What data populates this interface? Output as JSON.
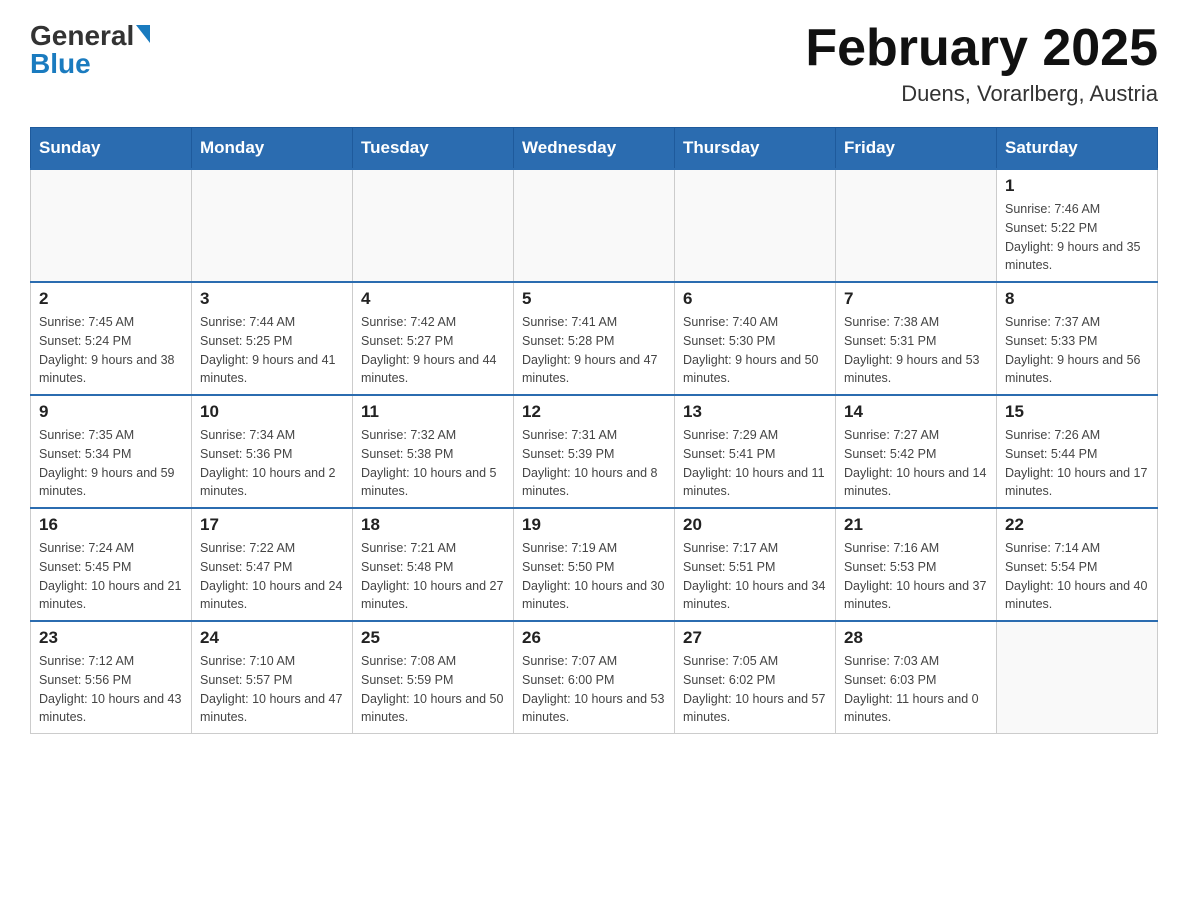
{
  "header": {
    "logo_general": "General",
    "logo_blue": "Blue",
    "month_title": "February 2025",
    "location": "Duens, Vorarlberg, Austria"
  },
  "weekdays": [
    "Sunday",
    "Monday",
    "Tuesday",
    "Wednesday",
    "Thursday",
    "Friday",
    "Saturday"
  ],
  "weeks": [
    [
      {
        "day": "",
        "info": ""
      },
      {
        "day": "",
        "info": ""
      },
      {
        "day": "",
        "info": ""
      },
      {
        "day": "",
        "info": ""
      },
      {
        "day": "",
        "info": ""
      },
      {
        "day": "",
        "info": ""
      },
      {
        "day": "1",
        "info": "Sunrise: 7:46 AM\nSunset: 5:22 PM\nDaylight: 9 hours and 35 minutes."
      }
    ],
    [
      {
        "day": "2",
        "info": "Sunrise: 7:45 AM\nSunset: 5:24 PM\nDaylight: 9 hours and 38 minutes."
      },
      {
        "day": "3",
        "info": "Sunrise: 7:44 AM\nSunset: 5:25 PM\nDaylight: 9 hours and 41 minutes."
      },
      {
        "day": "4",
        "info": "Sunrise: 7:42 AM\nSunset: 5:27 PM\nDaylight: 9 hours and 44 minutes."
      },
      {
        "day": "5",
        "info": "Sunrise: 7:41 AM\nSunset: 5:28 PM\nDaylight: 9 hours and 47 minutes."
      },
      {
        "day": "6",
        "info": "Sunrise: 7:40 AM\nSunset: 5:30 PM\nDaylight: 9 hours and 50 minutes."
      },
      {
        "day": "7",
        "info": "Sunrise: 7:38 AM\nSunset: 5:31 PM\nDaylight: 9 hours and 53 minutes."
      },
      {
        "day": "8",
        "info": "Sunrise: 7:37 AM\nSunset: 5:33 PM\nDaylight: 9 hours and 56 minutes."
      }
    ],
    [
      {
        "day": "9",
        "info": "Sunrise: 7:35 AM\nSunset: 5:34 PM\nDaylight: 9 hours and 59 minutes."
      },
      {
        "day": "10",
        "info": "Sunrise: 7:34 AM\nSunset: 5:36 PM\nDaylight: 10 hours and 2 minutes."
      },
      {
        "day": "11",
        "info": "Sunrise: 7:32 AM\nSunset: 5:38 PM\nDaylight: 10 hours and 5 minutes."
      },
      {
        "day": "12",
        "info": "Sunrise: 7:31 AM\nSunset: 5:39 PM\nDaylight: 10 hours and 8 minutes."
      },
      {
        "day": "13",
        "info": "Sunrise: 7:29 AM\nSunset: 5:41 PM\nDaylight: 10 hours and 11 minutes."
      },
      {
        "day": "14",
        "info": "Sunrise: 7:27 AM\nSunset: 5:42 PM\nDaylight: 10 hours and 14 minutes."
      },
      {
        "day": "15",
        "info": "Sunrise: 7:26 AM\nSunset: 5:44 PM\nDaylight: 10 hours and 17 minutes."
      }
    ],
    [
      {
        "day": "16",
        "info": "Sunrise: 7:24 AM\nSunset: 5:45 PM\nDaylight: 10 hours and 21 minutes."
      },
      {
        "day": "17",
        "info": "Sunrise: 7:22 AM\nSunset: 5:47 PM\nDaylight: 10 hours and 24 minutes."
      },
      {
        "day": "18",
        "info": "Sunrise: 7:21 AM\nSunset: 5:48 PM\nDaylight: 10 hours and 27 minutes."
      },
      {
        "day": "19",
        "info": "Sunrise: 7:19 AM\nSunset: 5:50 PM\nDaylight: 10 hours and 30 minutes."
      },
      {
        "day": "20",
        "info": "Sunrise: 7:17 AM\nSunset: 5:51 PM\nDaylight: 10 hours and 34 minutes."
      },
      {
        "day": "21",
        "info": "Sunrise: 7:16 AM\nSunset: 5:53 PM\nDaylight: 10 hours and 37 minutes."
      },
      {
        "day": "22",
        "info": "Sunrise: 7:14 AM\nSunset: 5:54 PM\nDaylight: 10 hours and 40 minutes."
      }
    ],
    [
      {
        "day": "23",
        "info": "Sunrise: 7:12 AM\nSunset: 5:56 PM\nDaylight: 10 hours and 43 minutes."
      },
      {
        "day": "24",
        "info": "Sunrise: 7:10 AM\nSunset: 5:57 PM\nDaylight: 10 hours and 47 minutes."
      },
      {
        "day": "25",
        "info": "Sunrise: 7:08 AM\nSunset: 5:59 PM\nDaylight: 10 hours and 50 minutes."
      },
      {
        "day": "26",
        "info": "Sunrise: 7:07 AM\nSunset: 6:00 PM\nDaylight: 10 hours and 53 minutes."
      },
      {
        "day": "27",
        "info": "Sunrise: 7:05 AM\nSunset: 6:02 PM\nDaylight: 10 hours and 57 minutes."
      },
      {
        "day": "28",
        "info": "Sunrise: 7:03 AM\nSunset: 6:03 PM\nDaylight: 11 hours and 0 minutes."
      },
      {
        "day": "",
        "info": ""
      }
    ]
  ]
}
